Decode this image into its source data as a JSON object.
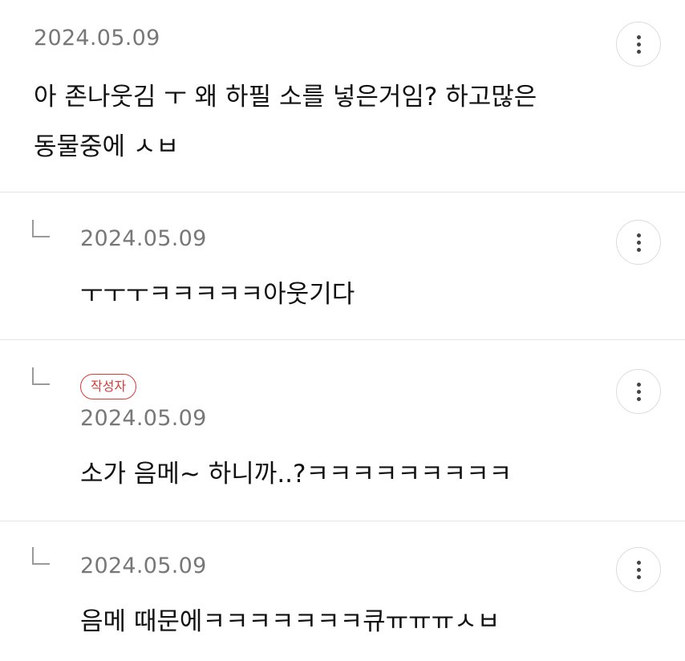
{
  "comments": [
    {
      "date": "2024.05.09",
      "lines": [
        "아 존나웃김 ㅜ 왜 하필 소를 넣은거임? 하고많은",
        "동물중에 ㅅㅂ"
      ],
      "is_reply": false
    },
    {
      "date": "2024.05.09",
      "lines": [
        "ㅜㅜㅜㅋㅋㅋㅋㅋ아웃기다"
      ],
      "is_reply": true
    },
    {
      "date": "2024.05.09",
      "badge": "작성자",
      "lines": [
        "소가 음메~ 하니까..?ㅋㅋㅋㅋㅋㅋㅋㅋㅋ"
      ],
      "is_reply": true
    },
    {
      "date": "2024.05.09",
      "lines": [
        "음메 때문에ㅋㅋㅋㅋㅋㅋㅋ큐ㅠㅠㅠㅅㅂ"
      ],
      "is_reply": true
    }
  ],
  "icons": {
    "more": "more-vertical-icon",
    "reply": "reply-arrow-icon"
  },
  "colors": {
    "badge": "#d93a3a",
    "date": "#777777",
    "divider": "#e5e5e5"
  }
}
